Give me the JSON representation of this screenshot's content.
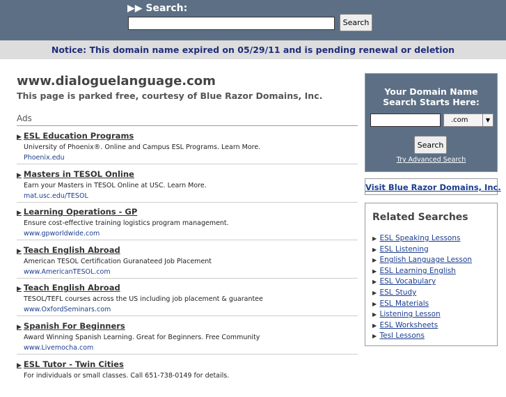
{
  "top_search": {
    "label": "▶▶ Search:",
    "input_value": "",
    "button_label": "Search"
  },
  "notice": "Notice: This domain name expired on 05/29/11 and is pending renewal or deletion",
  "domain": "www.dialoguelanguage.com",
  "parked_text": "This page is parked free, courtesy of Blue Razor Domains, Inc.",
  "ads_heading": "Ads",
  "ads": [
    {
      "title": "ESL Education Programs",
      "desc": "University of Phoenix®. Online and Campus ESL Programs. Learn More.",
      "url": "Phoenix.edu"
    },
    {
      "title": "Masters in TESOL Online",
      "desc": "Earn your Masters in TESOL Online at USC. Learn More.",
      "url": "mat.usc.edu/TESOL"
    },
    {
      "title": "Learning Operations - GP",
      "desc": "Ensure cost-effective training logistics program management.",
      "url": "www.gpworldwide.com"
    },
    {
      "title": "Teach English Abroad",
      "desc": "American TESOL Certification Guranateed Job Placement",
      "url": "www.AmericanTESOL.com"
    },
    {
      "title": "Teach English Abroad",
      "desc": "TESOL/TEFL courses across the US including job placement & guarantee",
      "url": "www.OxfordSeminars.com"
    },
    {
      "title": "Spanish For Beginners",
      "desc": "Award Winning Spanish Learning. Great for Beginners. Free Community",
      "url": "www.Livemocha.com"
    },
    {
      "title": "ESL Tutor - Twin Cities",
      "desc": "For individuals or small classes. Call 651-738-0149 for details.",
      "url": ""
    }
  ],
  "domain_search": {
    "heading_line1": "Your Domain Name",
    "heading_line2": "Search Starts Here:",
    "input_value": "",
    "tld_selected": ".com",
    "button_label": "Search",
    "advanced_link": "Try Advanced Search"
  },
  "visit_link": "Visit Blue Razor Domains, Inc.",
  "related": {
    "heading": "Related Searches",
    "items": [
      "ESL Speaking Lessons",
      "ESL Listening",
      "English Language Lesson",
      "ESL Learning English",
      "ESL Vocabulary",
      "ESL Study",
      "ESL Materials",
      "Listening Lesson",
      "ESL Worksheets",
      "Tesl Lessons"
    ]
  },
  "colors": {
    "header_bg": "#5c6f85",
    "notice_bg": "#dddddd",
    "notice_text": "#1f2d7a",
    "link": "#1a3d8f"
  }
}
